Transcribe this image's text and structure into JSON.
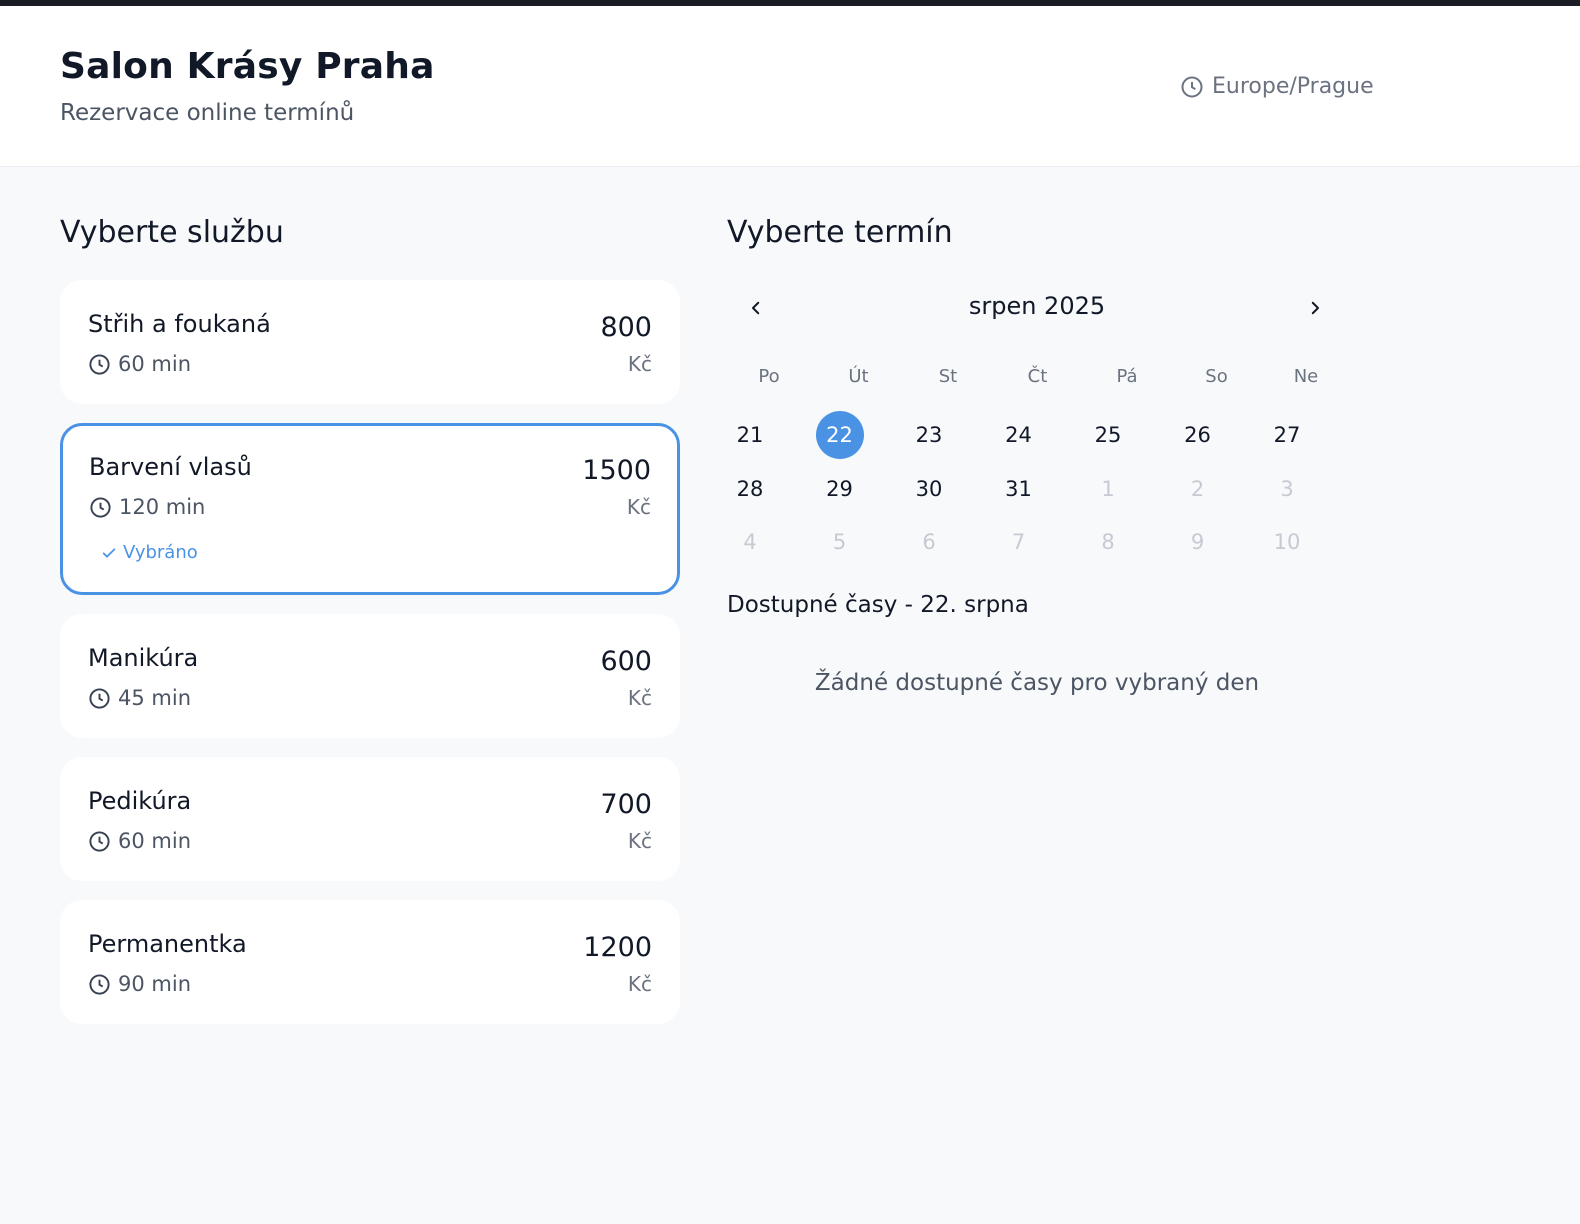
{
  "header": {
    "title": "Salon Krásy Praha",
    "subtitle": "Rezervace online termínů",
    "timezone": "Europe/Prague"
  },
  "services_section": {
    "title": "Vyberte službu",
    "items": [
      {
        "name": "Střih a foukaná",
        "duration": "60 min",
        "price": "800",
        "currency": "Kč",
        "selected": false
      },
      {
        "name": "Barvení vlasů",
        "duration": "120 min",
        "price": "1500",
        "currency": "Kč",
        "selected": true,
        "badge": "Vybráno"
      },
      {
        "name": "Manikúra",
        "duration": "45 min",
        "price": "600",
        "currency": "Kč",
        "selected": false
      },
      {
        "name": "Pedikúra",
        "duration": "60 min",
        "price": "700",
        "currency": "Kč",
        "selected": false
      },
      {
        "name": "Permanentka",
        "duration": "90 min",
        "price": "1200",
        "currency": "Kč",
        "selected": false
      }
    ]
  },
  "calendar_section": {
    "title": "Vyberte termín",
    "month_label": "srpen 2025",
    "weekdays": [
      "Po",
      "Út",
      "St",
      "Čt",
      "Pá",
      "So",
      "Ne"
    ],
    "weeks": [
      [
        "21",
        "22",
        "23",
        "24",
        "25",
        "26",
        "27"
      ],
      [
        "28",
        "29",
        "30",
        "31",
        "1",
        "2",
        "3"
      ],
      [
        "4",
        "5",
        "6",
        "7",
        "8",
        "9",
        "10"
      ]
    ],
    "muted_days": [
      [],
      [
        4,
        5,
        6
      ],
      [
        0,
        1,
        2,
        3,
        4,
        5,
        6
      ]
    ],
    "selected_day": "22"
  },
  "slots": {
    "title": "Dostupné časy - 22. srpna",
    "empty_text": "Žádné dostupné časy pro vybraný den"
  },
  "colors": {
    "accent": "#4a92e4",
    "text_primary": "#111827",
    "background": "#f8f9fb"
  }
}
